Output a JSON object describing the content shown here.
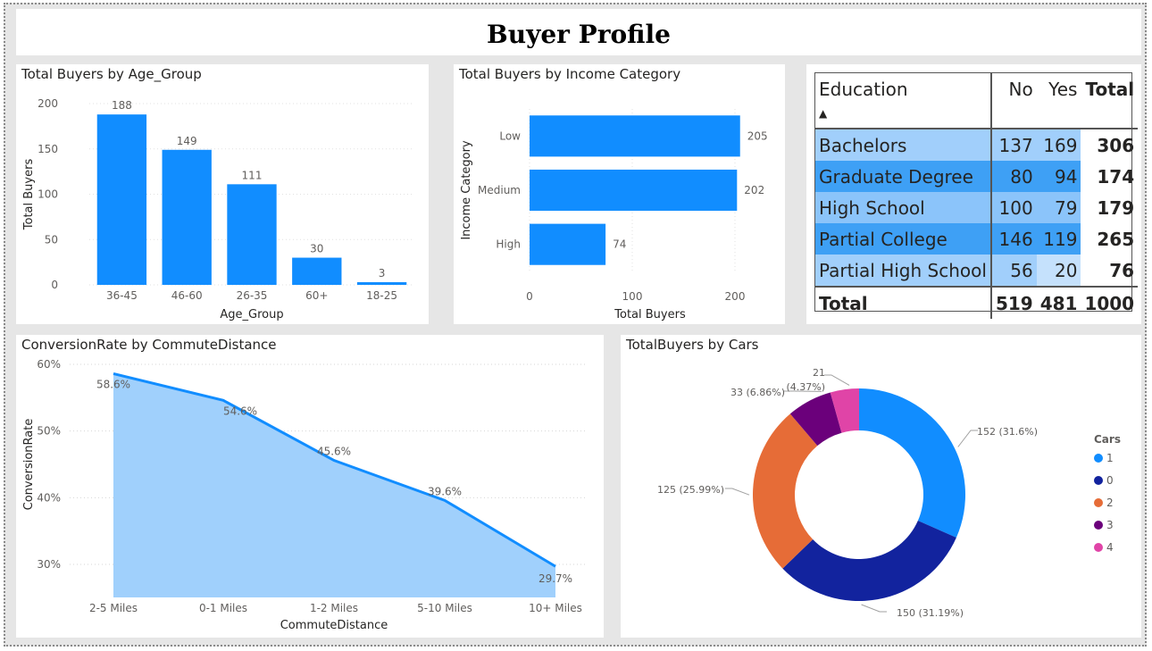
{
  "title": "Buyer Profile",
  "age_chart": {
    "title": "Total Buyers by Age_Group",
    "type": "bar",
    "xlabel": "Age_Group",
    "ylabel": "Total Buyers",
    "categories": [
      "36-45",
      "46-60",
      "26-35",
      "60+",
      "18-25"
    ],
    "values": [
      188,
      149,
      111,
      30,
      3
    ],
    "yticks": [
      "0",
      "50",
      "100",
      "150",
      "200"
    ],
    "ylim": [
      0,
      200
    ],
    "color": "#118dff"
  },
  "income_chart": {
    "title": "Total Buyers by Income Category",
    "type": "bar",
    "orientation": "horizontal",
    "xlabel": "Total Buyers",
    "ylabel": "Income Category",
    "categories": [
      "Low",
      "Medium",
      "High"
    ],
    "values": [
      205,
      202,
      74
    ],
    "xticks": [
      "0",
      "100",
      "200"
    ],
    "xlim": [
      0,
      200
    ],
    "color": "#118dff"
  },
  "education_table": {
    "headers": [
      "Education",
      "No",
      "Yes",
      "Total"
    ],
    "rows": [
      {
        "label": "Bachelors",
        "no": "137",
        "yes": "169",
        "total": "306"
      },
      {
        "label": "Graduate Degree",
        "no": "80",
        "yes": "94",
        "total": "174"
      },
      {
        "label": "High School",
        "no": "100",
        "yes": "79",
        "total": "179"
      },
      {
        "label": "Partial College",
        "no": "146",
        "yes": "119",
        "total": "265"
      },
      {
        "label": "Partial High School",
        "no": "56",
        "yes": "20",
        "total": "76"
      }
    ],
    "footer": {
      "label": "Total",
      "no": "519",
      "yes": "481",
      "total": "1000"
    }
  },
  "commute_chart": {
    "title": "ConversionRate by CommuteDistance",
    "type": "area",
    "xlabel": "CommuteDistance",
    "ylabel": "ConversionRate",
    "categories": [
      "2-5 Miles",
      "0-1 Miles",
      "1-2 Miles",
      "5-10 Miles",
      "10+ Miles"
    ],
    "values": [
      58.6,
      54.6,
      45.6,
      39.6,
      29.7
    ],
    "value_labels": [
      "58.6%",
      "54.6%",
      "45.6%",
      "39.6%",
      "29.7%"
    ],
    "yticks": [
      "30%",
      "40%",
      "50%",
      "60%"
    ],
    "ylim": [
      25,
      60
    ],
    "line_color": "#118dff",
    "fill_color": "#a0d0fc"
  },
  "cars_chart": {
    "title": "TotalBuyers by Cars",
    "type": "pie",
    "legend_title": "Cars",
    "legend_position": "right",
    "slices": [
      {
        "category": "1",
        "value": 152,
        "label": "152 (31.6%)",
        "color": "#118dff"
      },
      {
        "category": "0",
        "value": 150,
        "label": "150 (31.19%)",
        "color": "#12239e"
      },
      {
        "category": "2",
        "value": 125,
        "label": "125 (25.99%)",
        "color": "#e66c37"
      },
      {
        "category": "3",
        "value": 33,
        "label": "33 (6.86%)",
        "color": "#6b007b"
      },
      {
        "category": "4",
        "value": 21,
        "label": "21",
        "label2": "(4.37%)",
        "color": "#e044a7"
      }
    ]
  },
  "chart_data": [
    {
      "type": "bar",
      "title": "Total Buyers by Age_Group",
      "xlabel": "Age_Group",
      "ylabel": "Total Buyers",
      "categories": [
        "36-45",
        "46-60",
        "26-35",
        "60+",
        "18-25"
      ],
      "values": [
        188,
        149,
        111,
        30,
        3
      ],
      "ylim": [
        0,
        200
      ]
    },
    {
      "type": "bar",
      "title": "Total Buyers by Income Category",
      "xlabel": "Total Buyers",
      "ylabel": "Income Category",
      "categories": [
        "Low",
        "Medium",
        "High"
      ],
      "values": [
        205,
        202,
        74
      ]
    },
    {
      "type": "table",
      "title": "",
      "columns": [
        "Education",
        "No",
        "Yes",
        "Total"
      ],
      "rows": [
        [
          "Bachelors",
          137,
          169,
          306
        ],
        [
          "Graduate Degree",
          80,
          94,
          174
        ],
        [
          "High School",
          100,
          79,
          179
        ],
        [
          "Partial College",
          146,
          119,
          265
        ],
        [
          "Partial High School",
          56,
          20,
          76
        ],
        [
          "Total",
          519,
          481,
          1000
        ]
      ]
    },
    {
      "type": "area",
      "title": "ConversionRate by CommuteDistance",
      "xlabel": "CommuteDistance",
      "ylabel": "ConversionRate",
      "categories": [
        "2-5 Miles",
        "0-1 Miles",
        "1-2 Miles",
        "5-10 Miles",
        "10+ Miles"
      ],
      "values": [
        58.6,
        54.6,
        45.6,
        39.6,
        29.7
      ]
    },
    {
      "type": "pie",
      "title": "TotalBuyers by Cars",
      "categories": [
        "1",
        "0",
        "2",
        "3",
        "4"
      ],
      "values": [
        152,
        150,
        125,
        33,
        21
      ],
      "percent": [
        31.6,
        31.19,
        25.99,
        6.86,
        4.37
      ]
    }
  ]
}
